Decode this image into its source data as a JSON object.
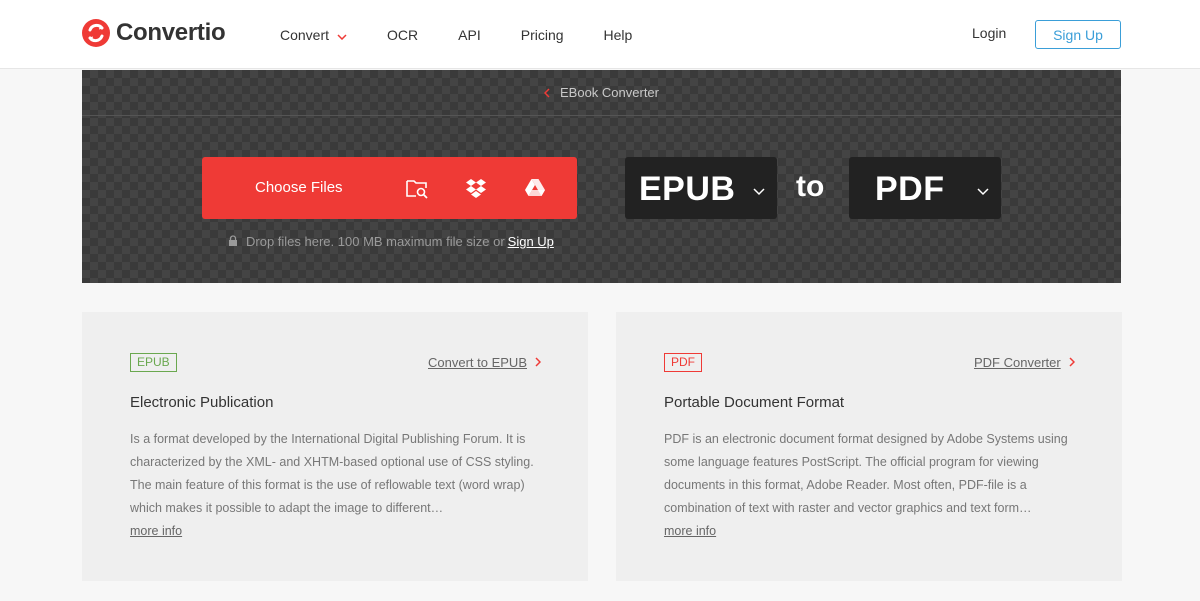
{
  "header": {
    "brand": "Convertio",
    "nav": [
      {
        "label": "Convert",
        "has_dropdown": true
      },
      {
        "label": "OCR"
      },
      {
        "label": "API"
      },
      {
        "label": "Pricing"
      },
      {
        "label": "Help"
      }
    ],
    "login_label": "Login",
    "signup_label": "Sign Up"
  },
  "hero": {
    "breadcrumb": "EBook Converter",
    "choose_files_label": "Choose Files",
    "upload_sources": [
      "folder-search-icon",
      "dropbox-icon",
      "google-drive-icon"
    ],
    "drop_note": "Drop files here. 100 MB maximum file size or",
    "drop_note_link": "Sign Up",
    "from_format": "EPUB",
    "to_word": "to",
    "to_format": "PDF"
  },
  "cards": [
    {
      "badge": "EPUB",
      "badge_color": "#6aa84f",
      "link": "Convert to EPUB",
      "title": "Electronic Publication",
      "description": "Is a format developed by the International Digital Publishing Forum. It is characterized by the XML- and XHTM-based optional use of CSS styling. The main feature of this format is the use of reflowable text (word wrap) which makes it possible to adapt the image to different…",
      "more": "more info"
    },
    {
      "badge": "PDF",
      "badge_color": "#ef3a36",
      "link": "PDF Converter",
      "title": "Portable Document Format",
      "description": "PDF is an electronic document format designed by Adobe Systems using some language features PostScript. The official program for viewing documents in this format, Adobe Reader. Most often, PDF-file is a combination of text with raster and vector graphics and text form…",
      "more": "more info"
    }
  ],
  "colors": {
    "accent": "#ef3a36",
    "link_blue": "#3a9ed8",
    "hero_bg": "#3a3a3a"
  }
}
